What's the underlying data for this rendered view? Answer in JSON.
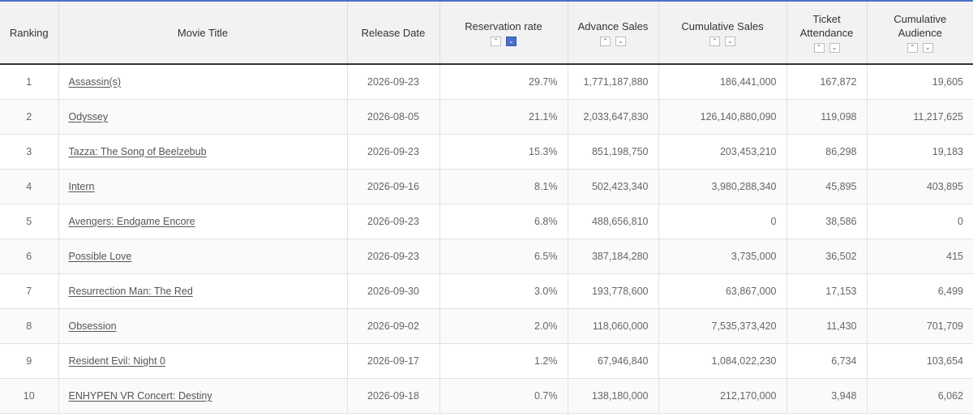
{
  "table": {
    "headers": {
      "ranking": "Ranking",
      "title": "Movie Title",
      "release": "Release Date",
      "rate": "Reservation rate",
      "advance": "Advance Sales",
      "cum_sales": "Cumulative Sales",
      "attendance_line1": "Ticket",
      "attendance_line2": "Attendance",
      "audience_line1": "Cumulative",
      "audience_line2": "Audience"
    },
    "sort_icons": {
      "up": "chevron-up-icon",
      "down": "chevron-down-icon",
      "up_glyph": "⌃",
      "down_glyph": "⌄",
      "active_column": "Reservation rate",
      "active_direction": "down",
      "active_color": "#4a6fc9"
    },
    "rows": [
      {
        "rank": "1",
        "title": "Assassin(s)",
        "release": "2026-09-23",
        "rate": "29.7%",
        "advance": "1,771,187,880",
        "cum_sales": "186,441,000",
        "attendance": "167,872",
        "audience": "19,605"
      },
      {
        "rank": "2",
        "title": "Odyssey",
        "release": "2026-08-05",
        "rate": "21.1%",
        "advance": "2,033,647,830",
        "cum_sales": "126,140,880,090",
        "attendance": "119,098",
        "audience": "11,217,625"
      },
      {
        "rank": "3",
        "title": "Tazza: The Song of Beelzebub",
        "release": "2026-09-23",
        "rate": "15.3%",
        "advance": "851,198,750",
        "cum_sales": "203,453,210",
        "attendance": "86,298",
        "audience": "19,183"
      },
      {
        "rank": "4",
        "title": "Intern",
        "release": "2026-09-16",
        "rate": "8.1%",
        "advance": "502,423,340",
        "cum_sales": "3,980,288,340",
        "attendance": "45,895",
        "audience": "403,895"
      },
      {
        "rank": "5",
        "title": "Avengers: Endgame Encore",
        "release": "2026-09-23",
        "rate": "6.8%",
        "advance": "488,656,810",
        "cum_sales": "0",
        "attendance": "38,586",
        "audience": "0"
      },
      {
        "rank": "6",
        "title": "Possible Love",
        "release": "2026-09-23",
        "rate": "6.5%",
        "advance": "387,184,280",
        "cum_sales": "3,735,000",
        "attendance": "36,502",
        "audience": "415"
      },
      {
        "rank": "7",
        "title": "Resurrection Man: The Red",
        "release": "2026-09-30",
        "rate": "3.0%",
        "advance": "193,778,600",
        "cum_sales": "63,867,000",
        "attendance": "17,153",
        "audience": "6,499"
      },
      {
        "rank": "8",
        "title": "Obsession",
        "release": "2026-09-02",
        "rate": "2.0%",
        "advance": "118,060,000",
        "cum_sales": "7,535,373,420",
        "attendance": "11,430",
        "audience": "701,709"
      },
      {
        "rank": "9",
        "title": "Resident Evil: Night 0",
        "release": "2026-09-17",
        "rate": "1.2%",
        "advance": "67,946,840",
        "cum_sales": "1,084,022,230",
        "attendance": "6,734",
        "audience": "103,654"
      },
      {
        "rank": "10",
        "title": "ENHYPEN VR Concert: Destiny",
        "release": "2026-09-18",
        "rate": "0.7%",
        "advance": "138,180,000",
        "cum_sales": "212,170,000",
        "attendance": "3,948",
        "audience": "6,062"
      }
    ]
  }
}
